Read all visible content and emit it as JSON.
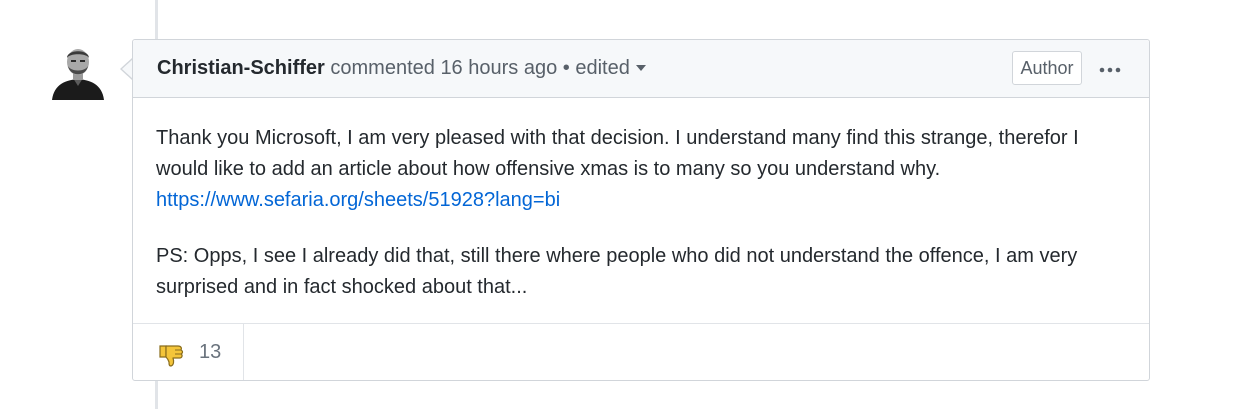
{
  "comment": {
    "author": "Christian-Schiffer",
    "action": "commented",
    "time": "16 hours ago",
    "separator": "•",
    "edited_label": "edited",
    "badge": "Author",
    "menu_icon": "kebab-horizontal-icon",
    "avatar_icon": "user-avatar",
    "paragraph_1": "Thank you Microsoft, I am very pleased with that decision. I understand many find this strange, therefor I would like to add an article about how offensive xmas is to many so you understand why.",
    "link": "https://www.sefaria.org/sheets/51928?lang=bi",
    "paragraph_2": "PS: Opps, I see I already did that, still there where people who did not understand the offence, I am very surprised and in fact shocked about that...",
    "reactions": [
      {
        "icon": "thumbs-down-icon",
        "count": "13"
      }
    ]
  },
  "colors": {
    "link": "#0366d6",
    "header_bg": "#f6f8fa",
    "border": "#d1d5da",
    "muted_text": "#586069",
    "emoji_yellow": "#f4c53a"
  }
}
